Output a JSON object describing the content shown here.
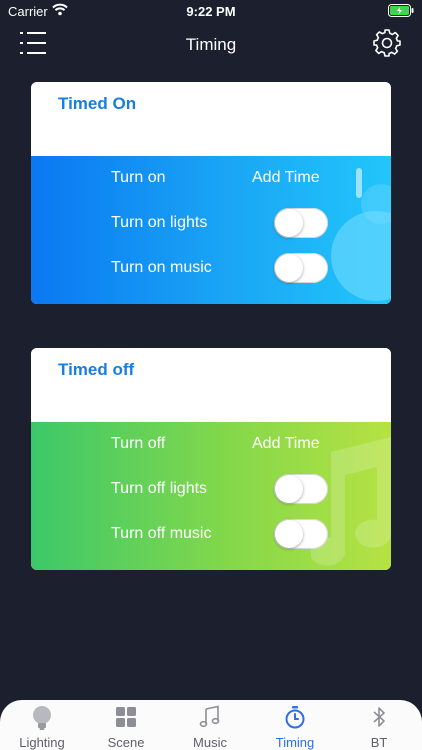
{
  "status_bar": {
    "carrier": "Carrier",
    "time": "9:22 PM"
  },
  "nav": {
    "title": "Timing"
  },
  "timed_on": {
    "title": "Timed On",
    "header_label": "Turn on",
    "add_time_label": "Add Time",
    "rows": [
      {
        "label": "Turn on lights",
        "enabled": false
      },
      {
        "label": "Turn on music",
        "enabled": false
      }
    ]
  },
  "timed_off": {
    "title": "Timed off",
    "header_label": "Turn off",
    "add_time_label": "Add Time",
    "rows": [
      {
        "label": "Turn off lights",
        "enabled": false
      },
      {
        "label": "Turn off music",
        "enabled": false
      }
    ]
  },
  "tabs": [
    {
      "label": "Lighting",
      "icon": "bulb-icon",
      "active": false
    },
    {
      "label": "Scene",
      "icon": "grid-icon",
      "active": false
    },
    {
      "label": "Music",
      "icon": "music-note-icon",
      "active": false
    },
    {
      "label": "Timing",
      "icon": "stopwatch-icon",
      "active": true
    },
    {
      "label": "BT",
      "icon": "bluetooth-icon",
      "active": false
    }
  ],
  "colors": {
    "background": "#1b1f2e",
    "title_blue": "#1a7de0",
    "active_tab": "#2f6ee8",
    "timed_on_gradient": [
      "#0a78f2",
      "#22c6fb"
    ],
    "timed_off_gradient": [
      "#3cc86a",
      "#b6e243"
    ]
  }
}
